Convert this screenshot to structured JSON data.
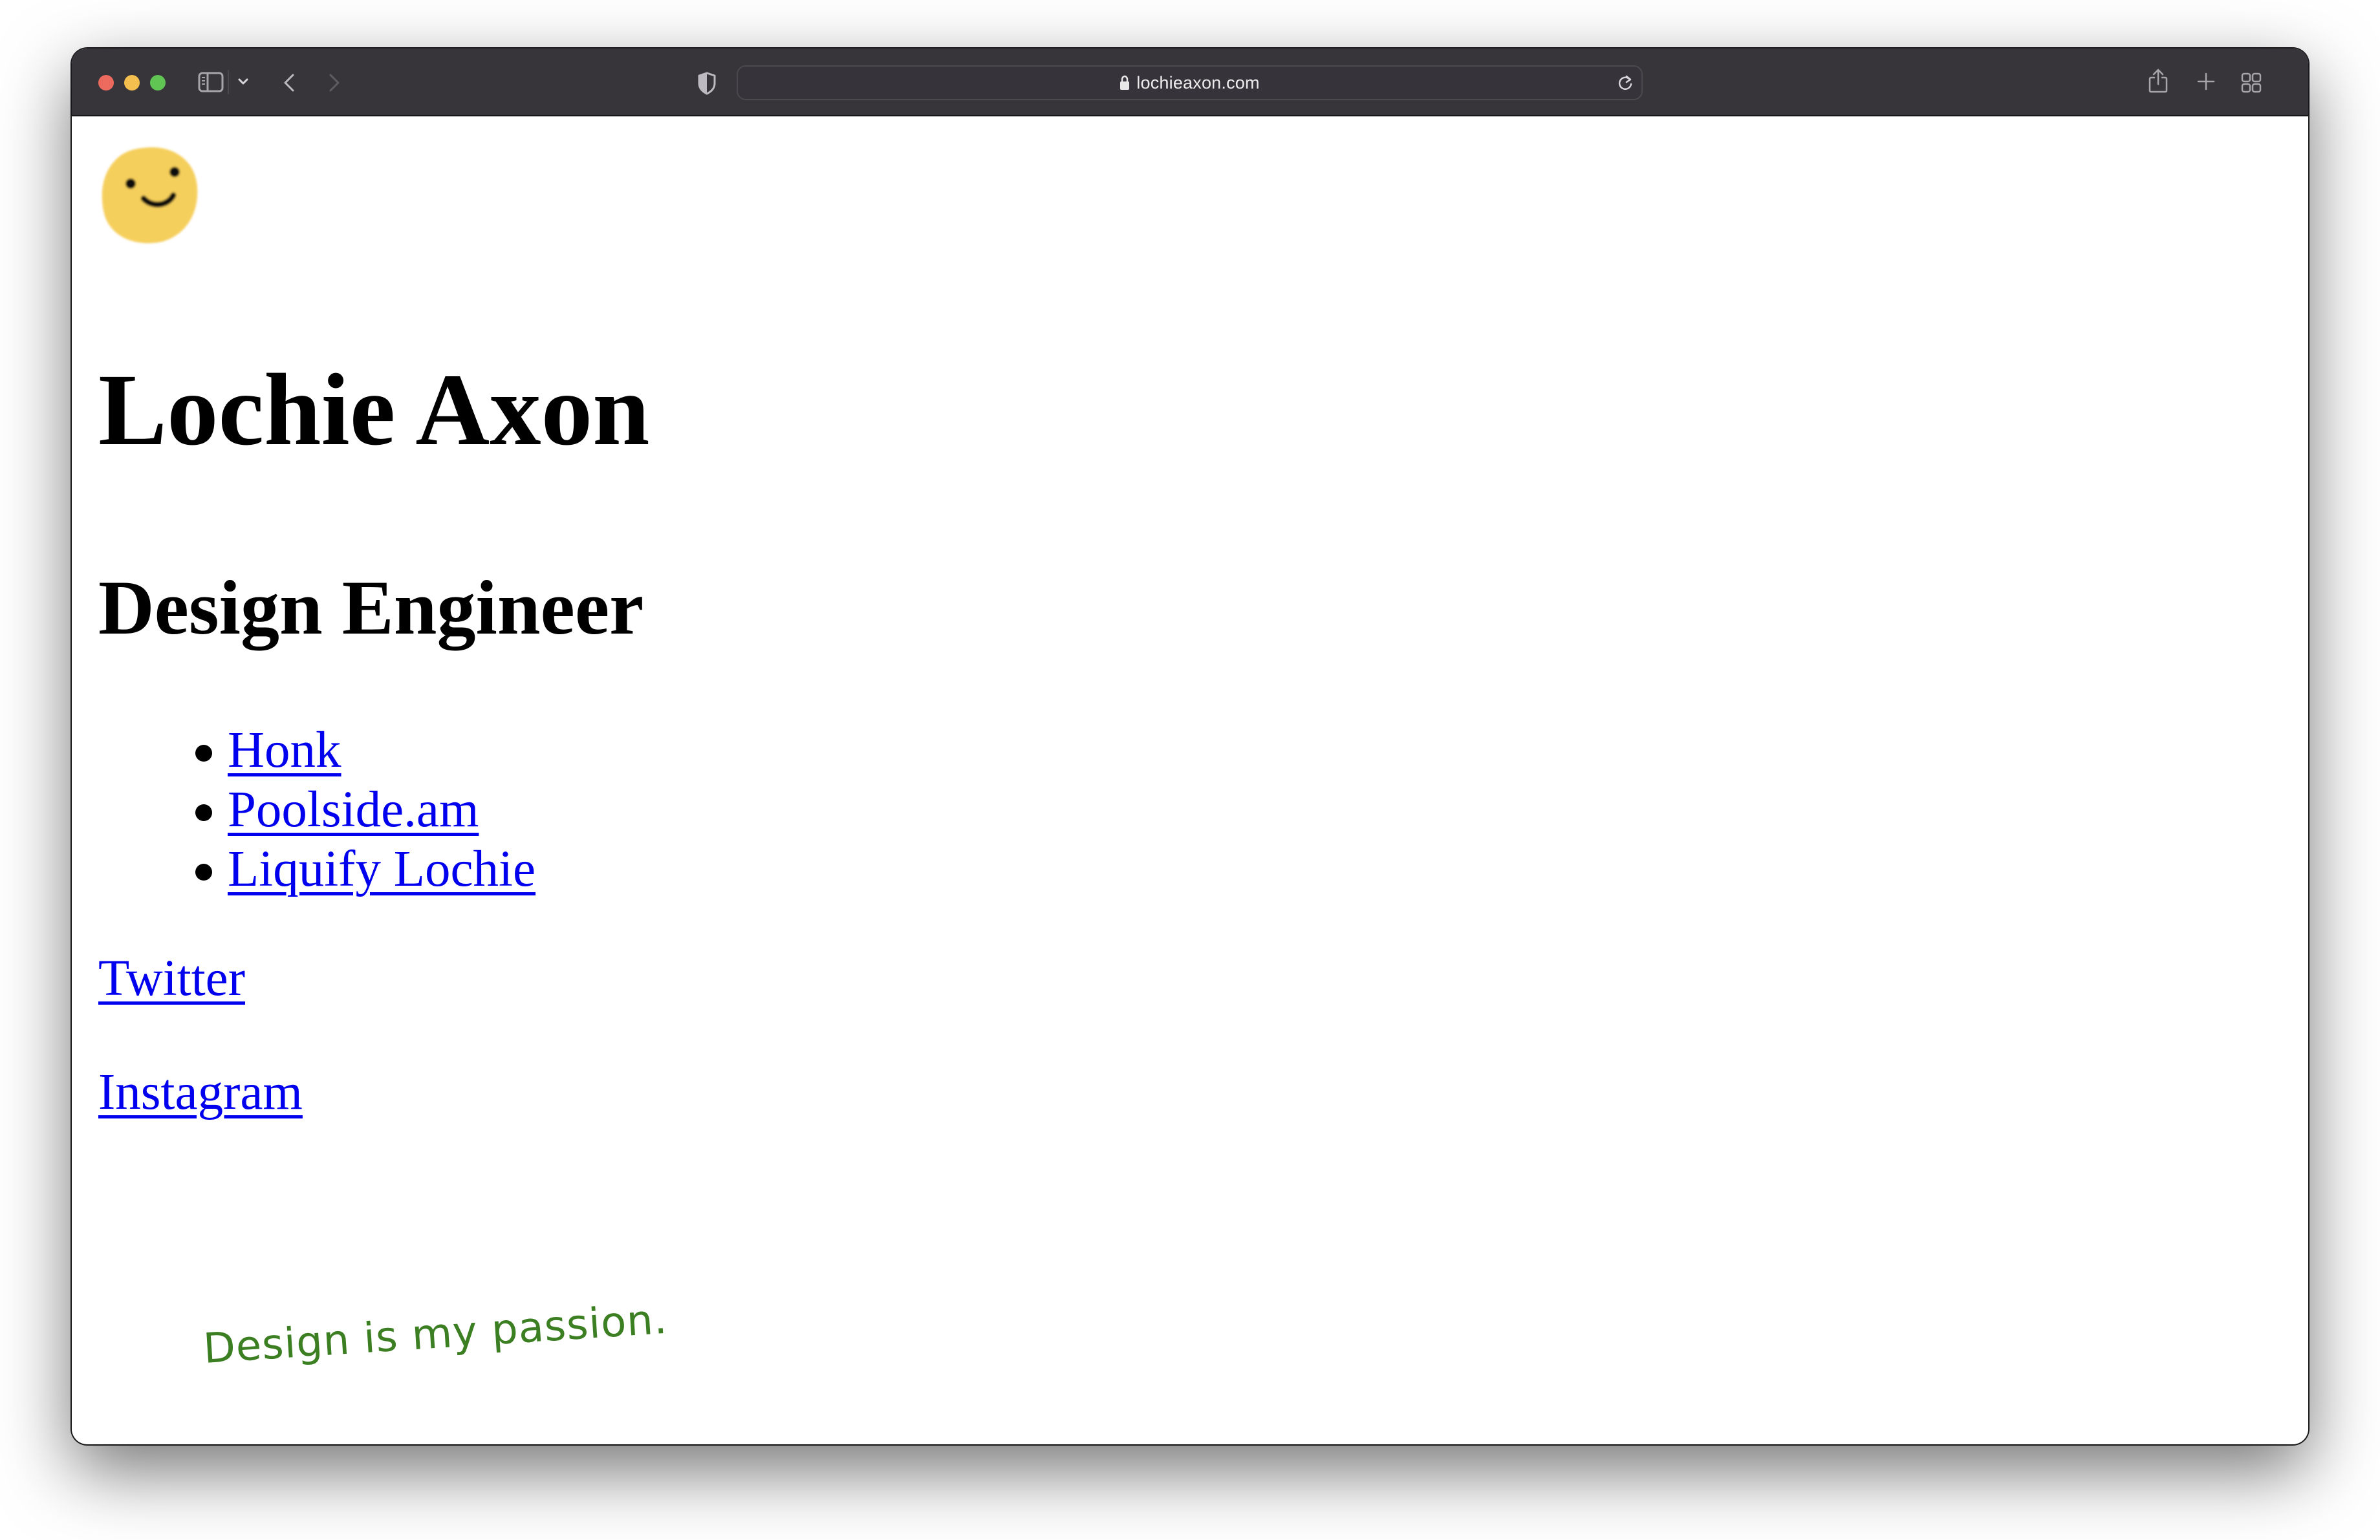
{
  "browser": {
    "url": "lochieaxon.com",
    "icons": {
      "close": "traffic-light-close",
      "minimize": "traffic-light-minimize",
      "maximize": "traffic-light-maximize",
      "sidebar": "sidebar-icon",
      "sidebar_menu": "chevron-down-icon",
      "back": "chevron-left-icon",
      "forward": "chevron-right-icon",
      "privacy": "shield-icon",
      "lock": "lock-icon",
      "reload": "reload-icon",
      "share": "share-icon",
      "new_tab": "plus-icon",
      "tab_overview": "grid-icon"
    },
    "colors": {
      "toolbar": "#37353a",
      "traffic_close": "#ec6a5e",
      "traffic_minimize": "#f4bf4f",
      "traffic_maximize": "#61c554"
    }
  },
  "page": {
    "avatar": "smiley-face-avatar",
    "title": "Lochie Axon",
    "subtitle": "Design Engineer",
    "projects": [
      {
        "label": "Honk"
      },
      {
        "label": "Poolside.am"
      },
      {
        "label": "Liquify Lochie"
      }
    ],
    "social": {
      "twitter": "Twitter",
      "instagram": "Instagram"
    },
    "tagline": "Design is my passion.",
    "colors": {
      "link": "#0000ee",
      "tagline": "#3b7f22",
      "avatar": "#f5cf5c"
    }
  }
}
